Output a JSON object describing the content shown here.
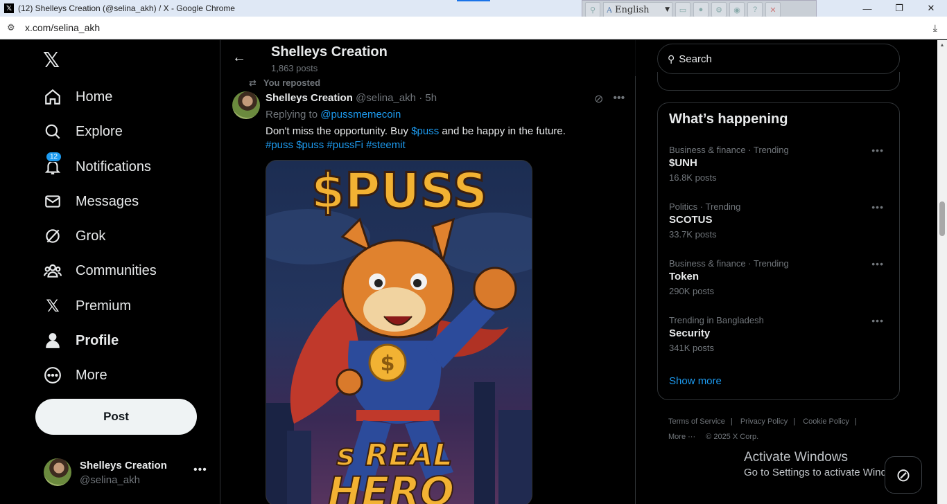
{
  "browser": {
    "window_title": "(12) Shelleys Creation (@selina_akh) / X - Google Chrome",
    "url": "x.com/selina_akh",
    "language": "English"
  },
  "nav": {
    "items": [
      {
        "label": "Home",
        "icon": "home-icon"
      },
      {
        "label": "Explore",
        "icon": "search-icon"
      },
      {
        "label": "Notifications",
        "icon": "bell-icon",
        "badge": "12"
      },
      {
        "label": "Messages",
        "icon": "mail-icon"
      },
      {
        "label": "Grok",
        "icon": "grok-icon"
      },
      {
        "label": "Communities",
        "icon": "people-icon"
      },
      {
        "label": "Premium",
        "icon": "x-logo-icon"
      },
      {
        "label": "Profile",
        "icon": "person-icon"
      },
      {
        "label": "More",
        "icon": "more-circle-icon"
      }
    ],
    "post_label": "Post",
    "account": {
      "name": "Shelleys Creation",
      "handle": "@selina_akh"
    }
  },
  "profile_header": {
    "title": "Shelleys Creation",
    "post_count": "1,863 posts"
  },
  "tweet": {
    "repost_label": "You reposted",
    "author": "Shelleys Creation",
    "handle": "@selina_akh",
    "time": "· 5h",
    "replying_prefix": "Replying to",
    "replying_to": "@pussmemecoin",
    "text_before": "Don't miss the opportunity. Buy",
    "text_cashtag": "$puss",
    "text_after": "and be happy in the future.",
    "hashtags": "#puss $puss #pussFi #steemit",
    "image_text_top": "$PUSS",
    "image_text_bottom1": "s REAL",
    "image_text_bottom2": "HERO"
  },
  "sidebar": {
    "search_placeholder": "Search",
    "trends_title": "What’s happening",
    "trends": [
      {
        "context": "Business & finance · Trending",
        "topic": "$UNH",
        "count": "16.8K posts"
      },
      {
        "context": "Politics · Trending",
        "topic": "SCOTUS",
        "count": "33.7K posts"
      },
      {
        "context": "Business & finance · Trending",
        "topic": "Token",
        "count": "290K posts"
      },
      {
        "context": "Trending in Bangladesh",
        "topic": "Security",
        "count": "341K posts"
      }
    ],
    "show_more": "Show more",
    "footer": {
      "terms": "Terms of Service",
      "privacy": "Privacy Policy",
      "cookie": "Cookie Policy",
      "more": "More ···",
      "copyright": "© 2025 X Corp."
    }
  },
  "windows_watermark": {
    "line1": "Activate Windows",
    "line2": "Go to Settings to activate Windows."
  },
  "colors": {
    "accent": "#1d9bf0",
    "background": "#000000",
    "text": "#e7e9ea",
    "muted": "#71767b",
    "puss_yellow": "#f2b233"
  }
}
